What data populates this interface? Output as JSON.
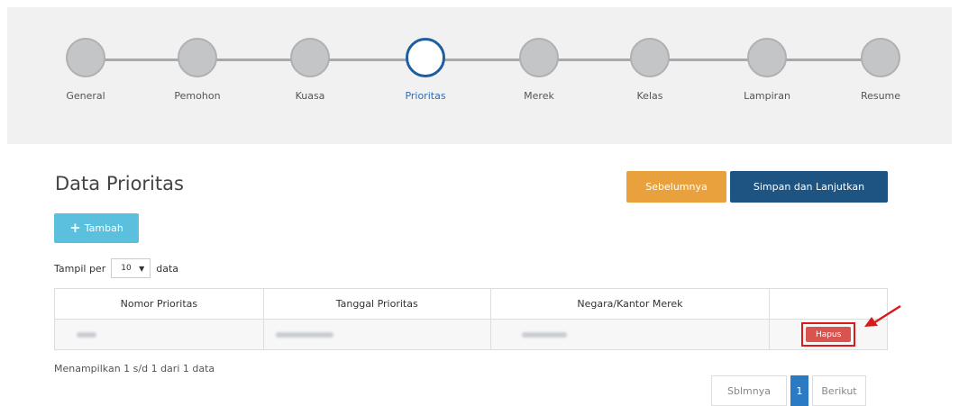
{
  "stepper": {
    "steps": [
      {
        "label": "General",
        "active": false
      },
      {
        "label": "Pemohon",
        "active": false
      },
      {
        "label": "Kuasa",
        "active": false
      },
      {
        "label": "Prioritas",
        "active": true
      },
      {
        "label": "Merek",
        "active": false
      },
      {
        "label": "Kelas",
        "active": false
      },
      {
        "label": "Lampiran",
        "active": false
      },
      {
        "label": "Resume",
        "active": false
      }
    ]
  },
  "header": {
    "title": "Data Prioritas",
    "prev_label": "Sebelumnya",
    "save_label": "Simpan dan Lanjutkan"
  },
  "toolbar": {
    "add_label": "Tambah"
  },
  "per_page": {
    "prefix": "Tampil per",
    "value": "10",
    "suffix": "data"
  },
  "table": {
    "columns": [
      "Nomor Prioritas",
      "Tanggal Prioritas",
      "Negara/Kantor Merek",
      ""
    ],
    "rows": [
      {
        "action_label": "Hapus"
      }
    ]
  },
  "footer": {
    "info": "Menampilkan 1 s/d 1 dari 1 data",
    "prev": "Sblmnya",
    "current": "1",
    "next": "Berikut"
  },
  "colors": {
    "accent": "#1d5482",
    "warning": "#e9a13e",
    "info": "#5bc0de",
    "danger": "#d9534f",
    "active_step": "#1d5ea0"
  }
}
